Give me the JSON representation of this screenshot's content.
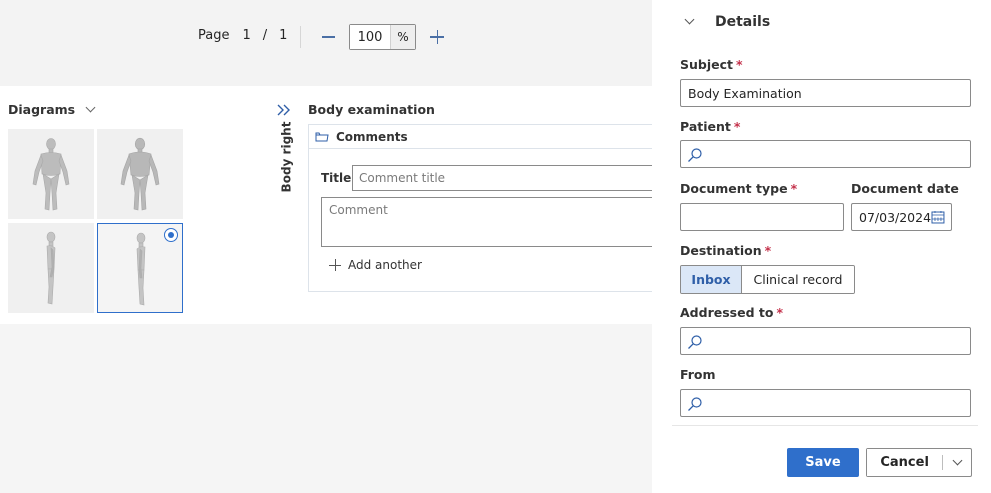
{
  "toolbar": {
    "page_label": "Page",
    "page_current": "1",
    "page_separator": "/",
    "page_total": "1",
    "zoom_value": "100",
    "zoom_unit": "%"
  },
  "diagrams": {
    "header": "Diagrams",
    "thumbnails": [
      {
        "view": "front",
        "selected": false
      },
      {
        "view": "back",
        "selected": false
      },
      {
        "view": "left",
        "selected": false
      },
      {
        "view": "right",
        "selected": true
      }
    ]
  },
  "body_view": {
    "vertical_label": "Body right",
    "section_title": "Body examination",
    "comments_header": "Comments",
    "title_label": "Title",
    "title_placeholder": "Comment title",
    "comment_placeholder": "Comment",
    "add_another_label": "Add another"
  },
  "details": {
    "header": "Details",
    "required_marker": "*",
    "subject": {
      "label": "Subject",
      "value": "Body Examination"
    },
    "patient": {
      "label": "Patient",
      "value": ""
    },
    "document_type": {
      "label": "Document type",
      "value": ""
    },
    "document_date": {
      "label": "Document date",
      "value": "07/03/2024"
    },
    "destination": {
      "label": "Destination",
      "options": [
        "Inbox",
        "Clinical record"
      ],
      "selected": "Inbox"
    },
    "addressed_to": {
      "label": "Addressed to",
      "value": ""
    },
    "from": {
      "label": "From",
      "value": ""
    }
  },
  "actions": {
    "save_label": "Save",
    "cancel_label": "Cancel"
  },
  "colors": {
    "primary": "#2f6fcb",
    "required": "#c4314b",
    "selected_segment_bg": "#dbe7f7"
  }
}
